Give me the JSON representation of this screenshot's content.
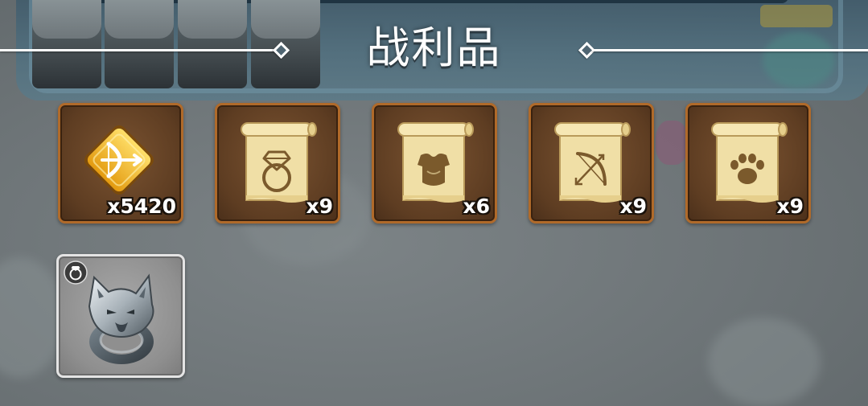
{
  "title": "战利品",
  "rewards": [
    {
      "item": "gold-bow-token",
      "icon": "bow-diamond-icon",
      "quantity": "x5420"
    },
    {
      "item": "ring-blueprint-scroll",
      "icon": "ring-scroll-icon",
      "quantity": "x9"
    },
    {
      "item": "armor-blueprint-scroll",
      "icon": "armor-scroll-icon",
      "quantity": "x6"
    },
    {
      "item": "weapon-blueprint-scroll",
      "icon": "bow-scroll-icon",
      "quantity": "x9"
    },
    {
      "item": "pet-blueprint-scroll",
      "icon": "paw-scroll-icon",
      "quantity": "x9"
    }
  ],
  "equipment": [
    {
      "item": "wolf-ring",
      "icon": "wolf-ring-icon",
      "type_badge": "ring-type-icon",
      "rarity_color": "#9a9a9a"
    }
  ],
  "colors": {
    "slot_border": "#b06a2a",
    "slot_fill": "#5e3d22",
    "gray_slot_border": "#e4e4e4",
    "scroll_paper": "#f0dfa6",
    "scroll_ink": "#7b5a2c",
    "gold": "#f2c12e"
  }
}
